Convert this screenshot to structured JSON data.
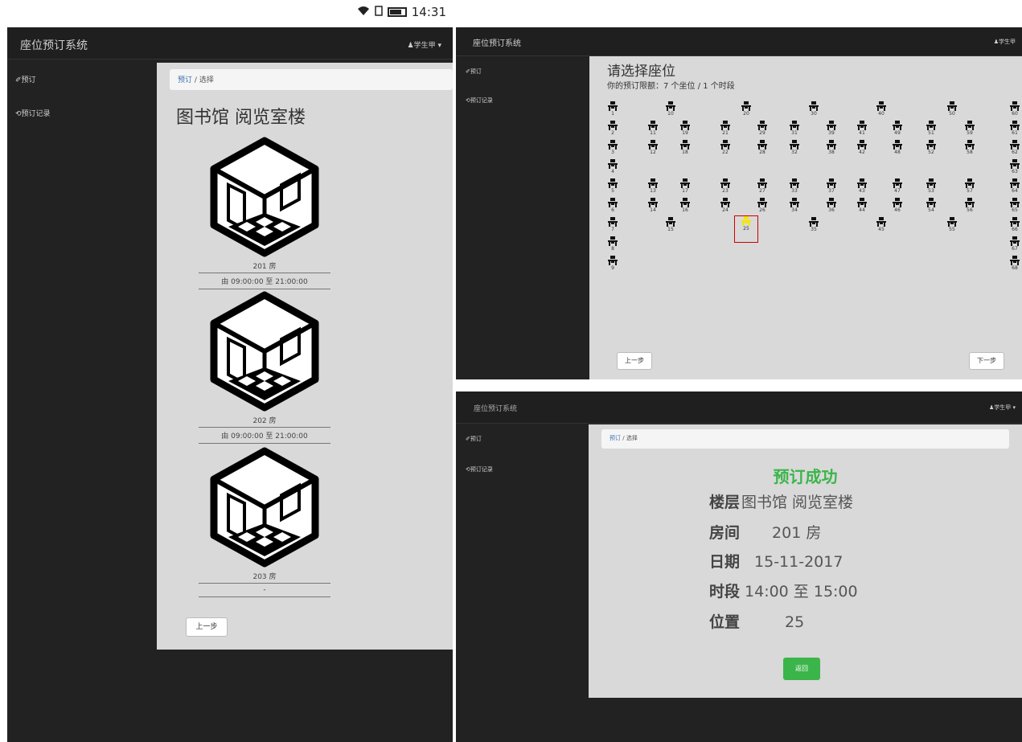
{
  "status": {
    "time": "14:31"
  },
  "panel_rooms": {
    "brand": "座位预订系统",
    "user": "♟学生甲 ▾",
    "sidebar": [
      {
        "icon": "pencil-icon",
        "label": "✐预订"
      },
      {
        "icon": "history-icon",
        "label": "⟲预订记录"
      }
    ],
    "breadcrumb": {
      "link": "预订",
      "sep": "/",
      "current": "选择"
    },
    "title": "图书馆 阅览室楼",
    "rooms": [
      {
        "name": "201 房",
        "time": "由 09:00:00 至 21:00:00"
      },
      {
        "name": "202 房",
        "time": "由 09:00:00 至 21:00:00"
      },
      {
        "name": "203 房",
        "time": "-"
      }
    ],
    "back_button": "上一步"
  },
  "panel_seats": {
    "brand": "座位预订系统",
    "user": "♟学生甲",
    "sidebar": [
      {
        "icon": "pencil-icon",
        "label": "✐预订"
      },
      {
        "icon": "history-icon",
        "label": "⟲预订记录"
      }
    ],
    "heading": "请选择座位",
    "quota": "你的预订限额：7 个坐位 / 1 个时段",
    "seats": [
      {
        "n": "1"
      },
      {
        "n": "10"
      },
      {
        "n": "20"
      },
      {
        "n": "30"
      },
      {
        "n": "40"
      },
      {
        "n": "50"
      },
      {
        "n": "60"
      },
      {
        "n": "2"
      },
      {
        "n": "11"
      },
      {
        "n": "19"
      },
      {
        "n": "21"
      },
      {
        "n": "29"
      },
      {
        "n": "31"
      },
      {
        "n": "39"
      },
      {
        "n": "41"
      },
      {
        "n": "49"
      },
      {
        "n": "51"
      },
      {
        "n": "59"
      },
      {
        "n": "61"
      },
      {
        "n": "3"
      },
      {
        "n": "12"
      },
      {
        "n": "18"
      },
      {
        "n": "22"
      },
      {
        "n": "28"
      },
      {
        "n": "32"
      },
      {
        "n": "38"
      },
      {
        "n": "42"
      },
      {
        "n": "48"
      },
      {
        "n": "52"
      },
      {
        "n": "58"
      },
      {
        "n": "62"
      },
      {
        "n": "4"
      },
      {
        "n": "63"
      },
      {
        "n": "5"
      },
      {
        "n": "13"
      },
      {
        "n": "17"
      },
      {
        "n": "23"
      },
      {
        "n": "27"
      },
      {
        "n": "33"
      },
      {
        "n": "37"
      },
      {
        "n": "43"
      },
      {
        "n": "47"
      },
      {
        "n": "53"
      },
      {
        "n": "57"
      },
      {
        "n": "64"
      },
      {
        "n": "6"
      },
      {
        "n": "14"
      },
      {
        "n": "16"
      },
      {
        "n": "24"
      },
      {
        "n": "26"
      },
      {
        "n": "34"
      },
      {
        "n": "36"
      },
      {
        "n": "44"
      },
      {
        "n": "46"
      },
      {
        "n": "54"
      },
      {
        "n": "56"
      },
      {
        "n": "65"
      },
      {
        "n": "7"
      },
      {
        "n": "15"
      },
      {
        "n": "25",
        "selected": true
      },
      {
        "n": "35"
      },
      {
        "n": "45"
      },
      {
        "n": "55"
      },
      {
        "n": "66"
      },
      {
        "n": "8"
      },
      {
        "n": "67"
      },
      {
        "n": "9"
      },
      {
        "n": "68"
      }
    ],
    "back_button": "上一步",
    "next_button": "下一步",
    "colors": {
      "selected_chair": "#f3e600",
      "selected_border": "#cc0000"
    }
  },
  "panel_success": {
    "brand": "座位预订系统",
    "user": "♟学生甲 ▾",
    "sidebar": [
      {
        "icon": "pencil-icon",
        "label": "✐预订"
      },
      {
        "icon": "history-icon",
        "label": "⟲预订记录"
      }
    ],
    "breadcrumb": {
      "link": "预订",
      "sep": "/",
      "current": "选择"
    },
    "title": "预订成功",
    "details": [
      {
        "key": "楼层",
        "value": "图书馆 阅览室楼"
      },
      {
        "key": "房间",
        "value": "201 房"
      },
      {
        "key": "日期",
        "value": "15-11-2017"
      },
      {
        "key": "时段",
        "value": "14:00 至 15:00"
      },
      {
        "key": "位置",
        "value": "25"
      }
    ],
    "ok_button": "返回",
    "colors": {
      "success": "#3bb54a"
    }
  }
}
